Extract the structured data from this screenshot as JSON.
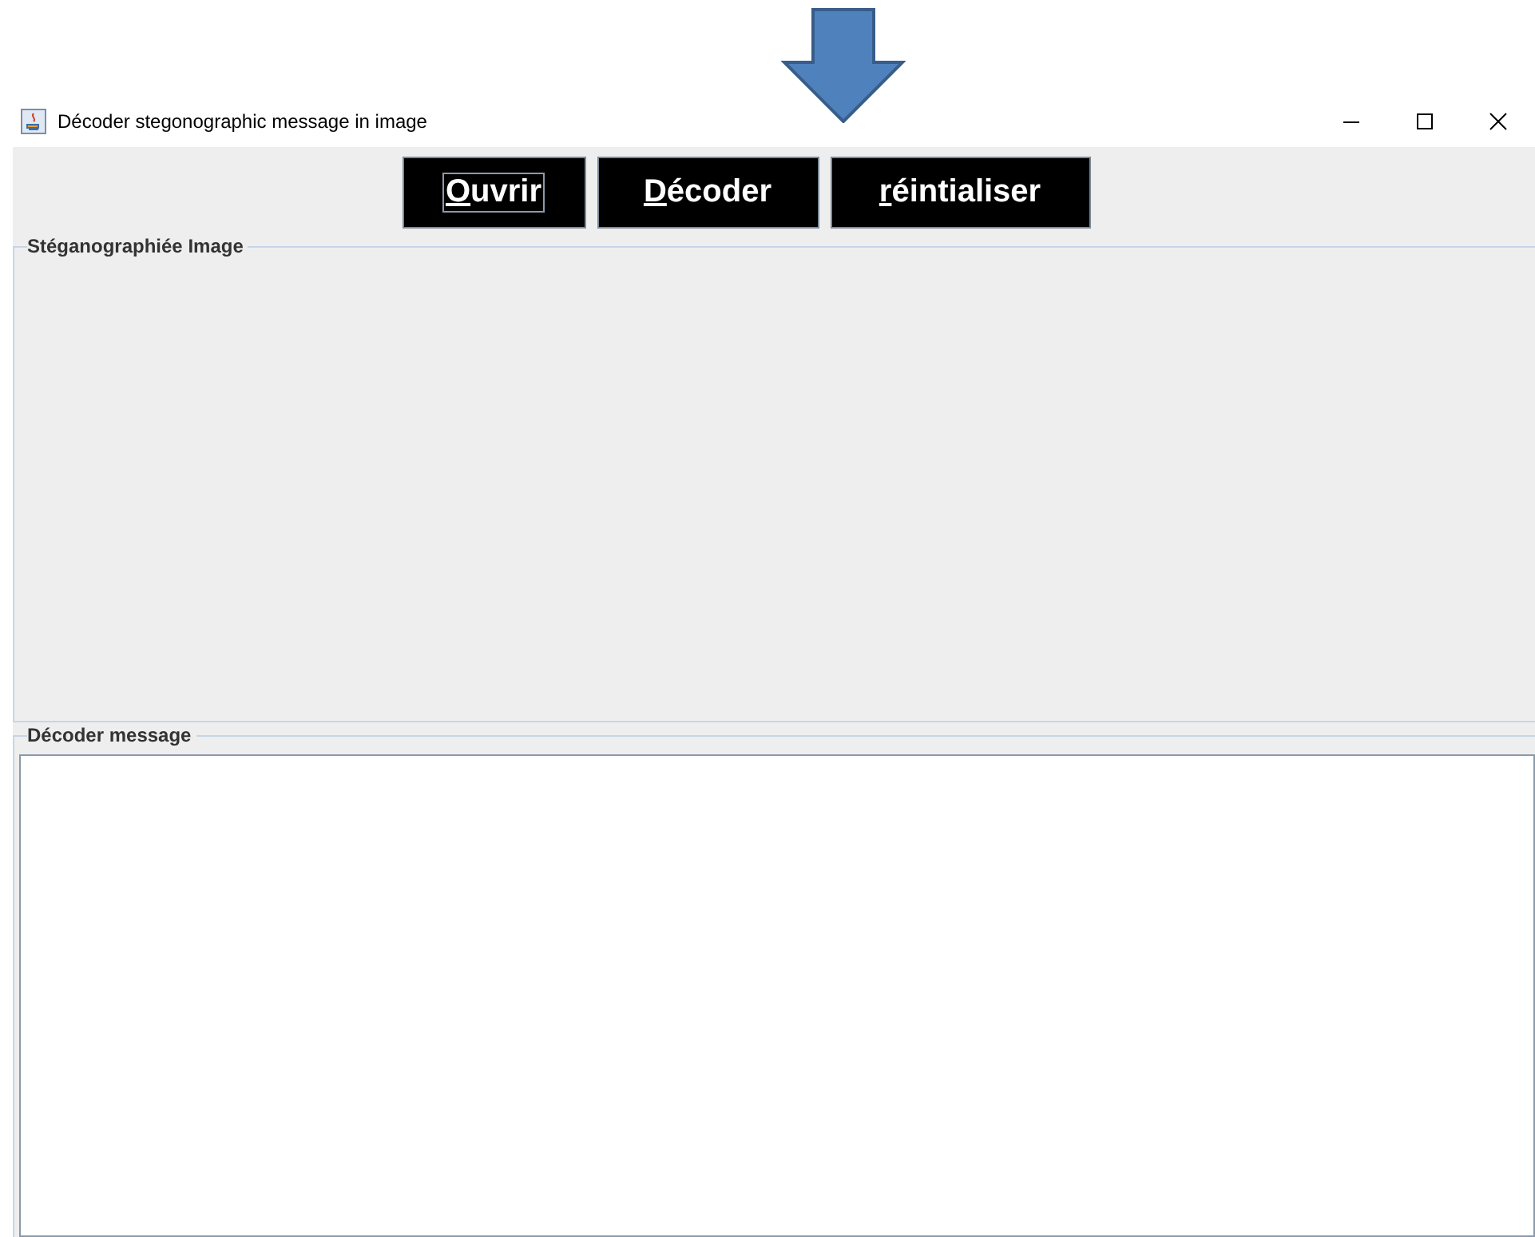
{
  "window": {
    "title": "Décoder stegonographic message in image"
  },
  "buttons": [
    {
      "label": "Ouvrir",
      "focused": true
    },
    {
      "label": "Décoder",
      "focused": false
    },
    {
      "label": "réintialiser",
      "focused": false
    }
  ],
  "image_panel": {
    "title": "Stéganographiée Image"
  },
  "message_panel": {
    "title": "Décoder message"
  }
}
